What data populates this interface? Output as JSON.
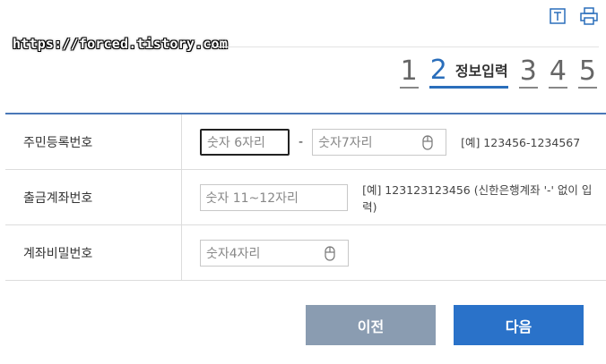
{
  "watermark": "https://forced.tistory.com",
  "steps": {
    "items": [
      "1",
      "2",
      "3",
      "4",
      "5"
    ],
    "active_label": "정보입력"
  },
  "form": {
    "rows": [
      {
        "label": "주민등록번호",
        "first_placeholder": "숫자 6자리",
        "dash": "-",
        "second_placeholder": "숫자7자리",
        "hint": "[예] 123456-1234567"
      },
      {
        "label": "출금계좌번호",
        "placeholder": "숫자 11~12자리",
        "hint": "[예] 123123123456 (신한은행계좌 '-' 없이 입력)"
      },
      {
        "label": "계좌비밀번호",
        "placeholder": "숫자4자리"
      }
    ]
  },
  "buttons": {
    "prev": "이전",
    "next": "다음"
  },
  "icons": [
    "text-size-icon",
    "print-icon",
    "mouse-icon"
  ],
  "colors": {
    "accent": "#2a6ebb",
    "prev_button": "#8a9cb1",
    "next_button": "#2a72c9"
  }
}
